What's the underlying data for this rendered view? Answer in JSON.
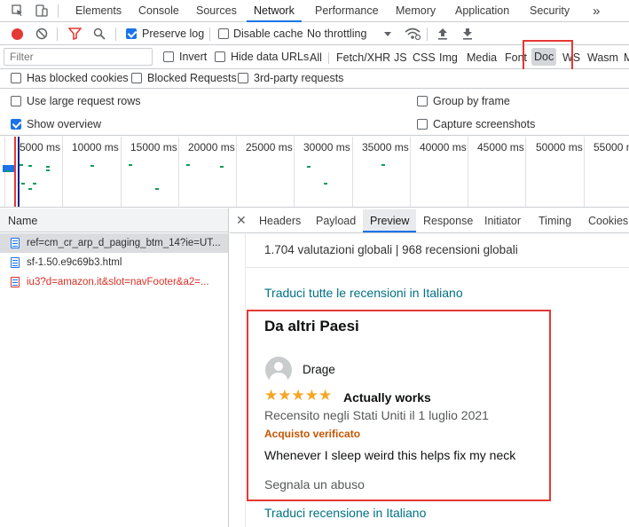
{
  "tabs": [
    "Elements",
    "Console",
    "Sources",
    "Network",
    "Performance",
    "Memory",
    "Application",
    "Security"
  ],
  "more_tabs": "»",
  "toolbar": {
    "preserve_log": "Preserve log",
    "disable_cache": "Disable cache",
    "throttling": "No throttling"
  },
  "filter": {
    "placeholder": "Filter",
    "invert": "Invert",
    "hide_data_urls": "Hide data URLs",
    "types": [
      "All",
      "Fetch/XHR",
      "JS",
      "CSS",
      "Img",
      "Media",
      "Font",
      "Doc",
      "WS",
      "Wasm",
      "M"
    ]
  },
  "options": {
    "has_blocked_cookies": "Has blocked cookies",
    "blocked_requests": "Blocked Requests",
    "third_party": "3rd-party requests",
    "large_rows": "Use large request rows",
    "group_by_frame": "Group by frame",
    "show_overview": "Show overview",
    "capture_screenshots": "Capture screenshots"
  },
  "timeline_ticks": [
    "5000 ms",
    "10000 ms",
    "15000 ms",
    "20000 ms",
    "25000 ms",
    "30000 ms",
    "35000 ms",
    "40000 ms",
    "45000 ms",
    "50000 ms",
    "55000 m"
  ],
  "requests": {
    "header": "Name",
    "items": [
      "ref=cm_cr_arp_d_paging_btm_14?ie=UT...",
      "sf-1.50.e9c69b3.html",
      "iu3?d=amazon.it&slot=navFooter&a2=..."
    ]
  },
  "panel_tabs": [
    "Headers",
    "Payload",
    "Preview",
    "Response",
    "Initiator",
    "Timing",
    "Cookies"
  ],
  "preview": {
    "cut_line": "1.704 valutazioni globali | 968 recensioni globali",
    "translate_all": "Traduci tutte le recensioni in Italiano",
    "section_title": "Da altri Paesi",
    "reviewer": "Drage",
    "stars": "★★★★★",
    "review_title": "Actually works",
    "review_meta": "Recensito negli Stati Uniti il 1 luglio 2021",
    "verified": "Acquisto verificato",
    "review_body": "Whenever I sleep weird this helps fix my neck",
    "report": "Segnala un abuso",
    "translate_review": "Traduci recensione in Italiano"
  },
  "colors": {
    "accent": "#1a73e8",
    "link": "#007185",
    "verified": "#c45500",
    "highlight": "#e53935"
  }
}
